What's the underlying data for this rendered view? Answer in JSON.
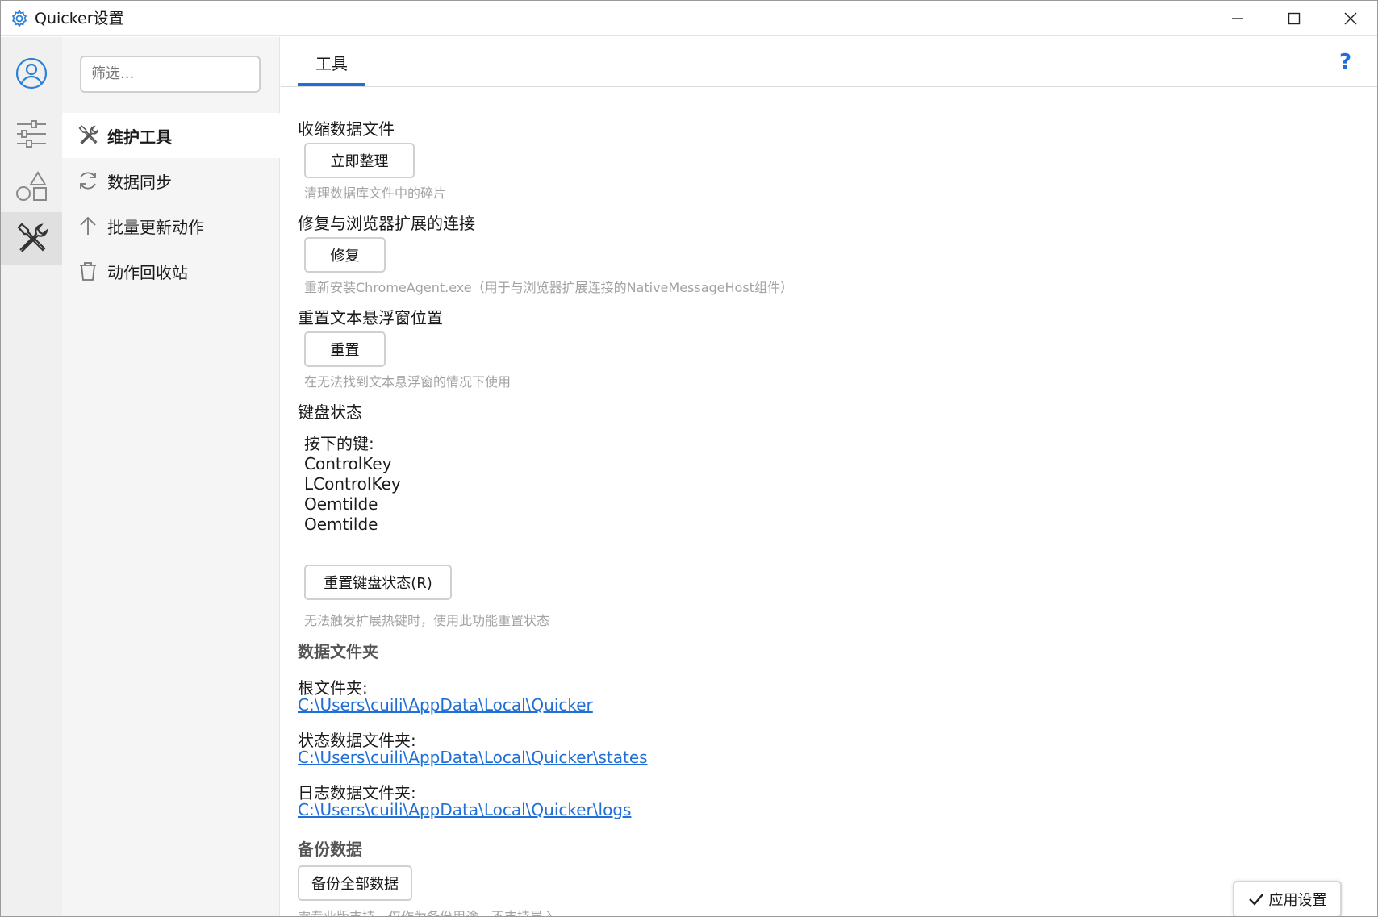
{
  "window": {
    "title": "Quicker设置"
  },
  "rail": {
    "items": [
      {
        "icon": "user-circle-icon",
        "active": false
      },
      {
        "icon": "sliders-icon",
        "active": false
      },
      {
        "icon": "shapes-icon",
        "active": false
      },
      {
        "icon": "tools-icon",
        "active": true
      }
    ]
  },
  "nav": {
    "filter_placeholder": "筛选...",
    "items": [
      {
        "label": "维护工具",
        "icon": "tools-icon"
      },
      {
        "label": "数据同步",
        "icon": "sync-icon"
      },
      {
        "label": "批量更新动作",
        "icon": "arrow-up-icon"
      },
      {
        "label": "动作回收站",
        "icon": "trash-icon"
      }
    ]
  },
  "tabs": {
    "active": "工具"
  },
  "help_label": "?",
  "sections": {
    "compress": {
      "title": "收缩数据文件",
      "button": "立即整理",
      "hint": "清理数据库文件中的碎片"
    },
    "repair": {
      "title": "修复与浏览器扩展的连接",
      "button": "修复",
      "hint": "重新安装ChromeAgent.exe（用于与浏览器扩展连接的NativeMessageHost组件）"
    },
    "reset_float": {
      "title": "重置文本悬浮窗位置",
      "button": "重置",
      "hint": "在无法找到文本悬浮窗的情况下使用"
    },
    "keyboard": {
      "title": "键盘状态",
      "pressed_label": "按下的键:",
      "keys": [
        "ControlKey",
        "LControlKey",
        "Oemtilde",
        "Oemtilde"
      ],
      "button": "重置键盘状态(R)",
      "hint": "无法触发扩展热键时，使用此功能重置状态"
    },
    "data_folder": {
      "title": "数据文件夹",
      "root_label": "根文件夹:",
      "root_path": "C:\\Users\\cuili\\AppData\\Local\\Quicker",
      "state_label": "状态数据文件夹:",
      "state_path": "C:\\Users\\cuili\\AppData\\Local\\Quicker\\states",
      "log_label": "日志数据文件夹:",
      "log_path": "C:\\Users\\cuili\\AppData\\Local\\Quicker\\logs"
    },
    "backup": {
      "title": "备份数据",
      "button": "备份全部数据",
      "hint": "需专业版支持，仅作为备份用途，不支持导入"
    }
  },
  "apply_button": "应用设置",
  "colors": {
    "accent": "#1f6fd6",
    "rail_bg": "#f0f0f0",
    "nav_bg": "#f5f5f5",
    "hint": "#a3a3a3"
  }
}
